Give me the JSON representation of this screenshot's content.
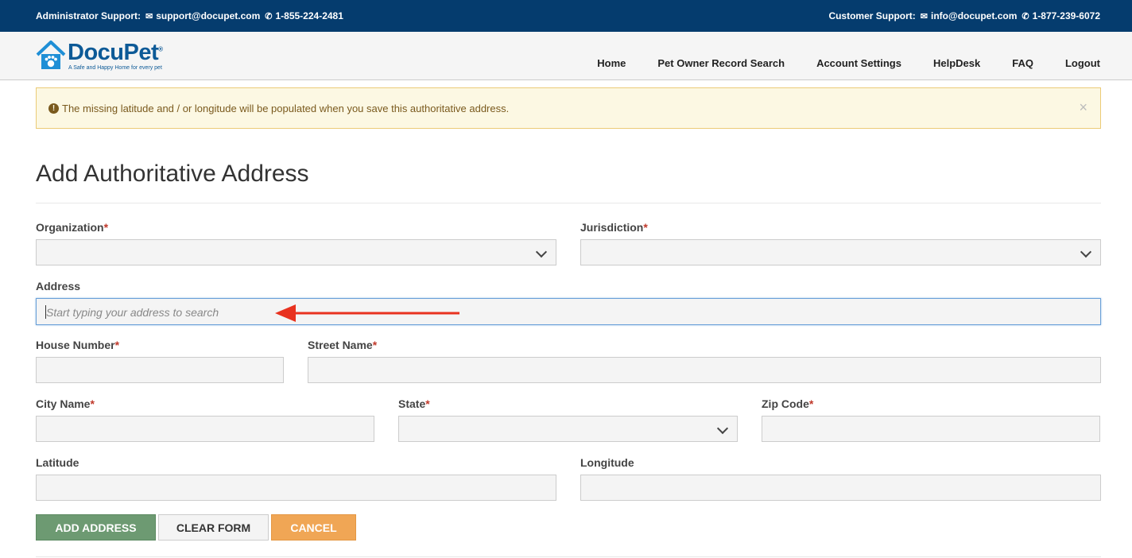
{
  "topbar": {
    "admin_label": "Administrator Support:",
    "admin_email": "support@docupet.com",
    "admin_phone": "1-855-224-2481",
    "customer_label": "Customer Support:",
    "customer_email": "info@docupet.com",
    "customer_phone": "1-877-239-6072",
    "email_icon": "envelope-icon",
    "phone_icon": "phone-icon"
  },
  "logo": {
    "name": "DocuPet",
    "tagline": "A Safe and Happy Home for every pet",
    "trademark": "®"
  },
  "nav": {
    "home": "Home",
    "search": "Pet Owner Record Search",
    "account": "Account Settings",
    "helpdesk": "HelpDesk",
    "faq": "FAQ",
    "logout": "Logout"
  },
  "alert": {
    "icon": "!",
    "message": "The missing latitude and / or longitude will be populated when you save this authoritative address.",
    "close": "×"
  },
  "page": {
    "title": "Add Authoritative Address"
  },
  "form": {
    "required_mark": "*",
    "organization_label": "Organization",
    "jurisdiction_label": "Jurisdiction",
    "address_label": "Address",
    "address_placeholder": "Start typing your address to search",
    "house_number_label": "House Number",
    "street_name_label": "Street Name",
    "city_name_label": "City Name",
    "state_label": "State",
    "zip_code_label": "Zip Code",
    "latitude_label": "Latitude",
    "longitude_label": "Longitude"
  },
  "buttons": {
    "add": "ADD ADDRESS",
    "clear": "CLEAR FORM",
    "cancel": "CANCEL"
  },
  "colors": {
    "topbar": "#053c6e",
    "brand": "#0d5a97",
    "add_button": "#6d9a72",
    "cancel_button": "#f0a655",
    "alert_bg": "#fcf8e3",
    "annotation_arrow": "#e8321f"
  }
}
